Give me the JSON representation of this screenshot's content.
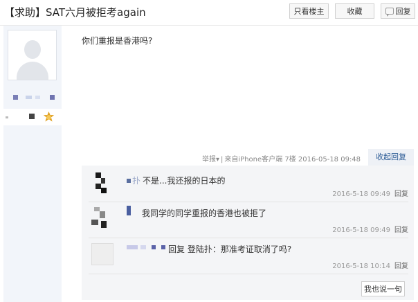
{
  "thread": {
    "title": "【求助】SAT六月被拒考again"
  },
  "toolbar": {
    "only_author": "只看楼主",
    "favorite": "收藏",
    "reply": "回复"
  },
  "post": {
    "content": "你们重报是香港吗?",
    "meta": {
      "report": "举报▾",
      "source": "来自iPhone客户端",
      "floor": "7楼",
      "time": "2016-05-18 09:48"
    },
    "collapse_reply": "收起回复"
  },
  "comments": [
    {
      "user": "扑",
      "text": "不是...我还报的日本的",
      "time": "2016-5-18 09:49",
      "reply": "回复"
    },
    {
      "user": "",
      "text": "我同学的同学重报的香港也被拒了",
      "time": "2016-5-18 09:49",
      "reply": "回复"
    },
    {
      "user": "",
      "text": "回复 登陆扑：那准考证取消了吗?",
      "time": "2016-5-18 10:14",
      "reply": "回复"
    }
  ],
  "say_button": "我也说一句",
  "colors": {
    "link": "#2a5a95",
    "sidebar_bg": "#f2f5fa",
    "comment_bg": "#f4f5f7",
    "badge": "#e0a020"
  }
}
